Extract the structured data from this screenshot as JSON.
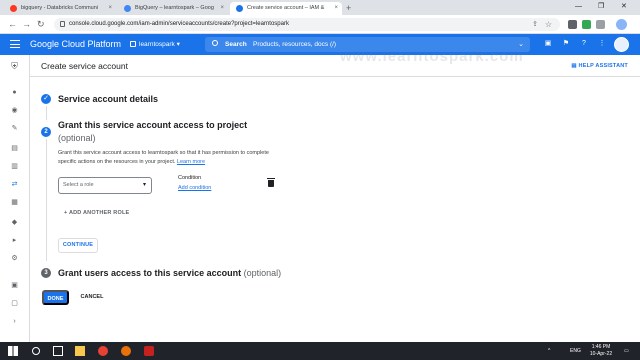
{
  "browser": {
    "tabs": [
      {
        "label": "bigquery - Databricks Communi",
        "fav_color": "#ff3621"
      },
      {
        "label": "BigQuery – learntospark – Goog",
        "fav_color": "#4285f4"
      },
      {
        "label": "Create service account – IAM &",
        "fav_color": "#1a73e8"
      }
    ],
    "new_tab": "+",
    "close_glyph": "×",
    "address": "console.cloud.google.com/iam-admin/serviceaccounts/create?project=learntospark",
    "window_controls": {
      "minimize": "—",
      "maximize": "❐",
      "close": "✕"
    }
  },
  "header": {
    "brand": "Google Cloud Platform",
    "project": "learntospark",
    "search_label": "Search",
    "search_placeholder": "Products, resources, docs (/)",
    "bg_color": "#1a73e8"
  },
  "page": {
    "title": "Create service account",
    "help_assistant": "HELP ASSISTANT",
    "watermark": "www.learntospark.com"
  },
  "steps": {
    "step1": {
      "title": "Service account details",
      "icon": "check-icon"
    },
    "step2": {
      "number": "2",
      "title": "Grant this service account access to project",
      "optional": "(optional)",
      "description": "Grant this service account access to learntospark so that it has permission to complete specific actions on the resources in your project.",
      "learn_more": "Learn more",
      "role_placeholder": "Select a role",
      "condition_label": "Condition",
      "add_condition": "Add condition",
      "add_role": "ADD ANOTHER ROLE",
      "continue": "CONTINUE"
    },
    "step3": {
      "number": "3",
      "title": "Grant users access to this service account",
      "optional": "(optional)"
    }
  },
  "actions": {
    "done": "DONE",
    "cancel": "CANCEL"
  },
  "taskbar": {
    "lang": "ENG",
    "time": "1:46 PM",
    "date": "10-Apr-22"
  }
}
